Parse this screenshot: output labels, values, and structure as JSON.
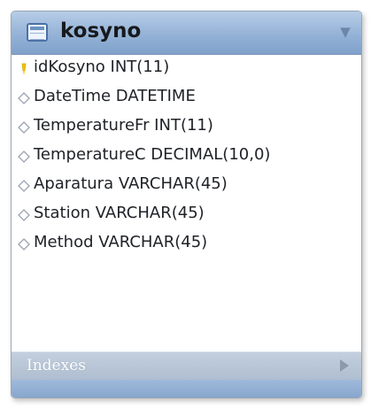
{
  "table": {
    "name": "kosyno",
    "icons": {
      "table": "table-icon",
      "dropdown": "chevron-down-icon"
    }
  },
  "columns": [
    {
      "label": "idKosyno INT(11)",
      "icon": "primary-key-icon"
    },
    {
      "label": "DateTime DATETIME",
      "icon": "column-diamond-icon"
    },
    {
      "label": "TemperatureFr INT(11)",
      "icon": "column-diamond-icon"
    },
    {
      "label": "TemperatureC DECIMAL(10,0)",
      "icon": "column-diamond-icon"
    },
    {
      "label": "Aparatura VARCHAR(45)",
      "icon": "column-diamond-icon"
    },
    {
      "label": "Station VARCHAR(45)",
      "icon": "column-diamond-icon"
    },
    {
      "label": "Method VARCHAR(45)",
      "icon": "column-diamond-icon"
    }
  ],
  "indexes": {
    "label": "Indexes",
    "icon": "expand-arrow-icon"
  },
  "colors": {
    "header": "#94b2d6",
    "key": "#f2c200",
    "diamond": "#9aa4b0",
    "indexes_bar": "#b3c1d3"
  }
}
